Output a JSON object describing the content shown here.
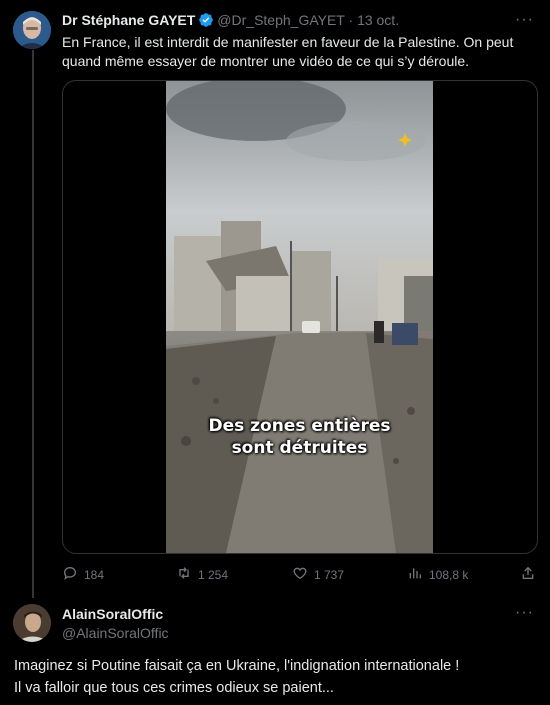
{
  "tweet1": {
    "display_name": "Dr Stéphane GAYET",
    "handle": "@Dr_Steph_GAYET",
    "separator": "·",
    "time": "13 oct.",
    "text": "En France, il est interdit de manifester en faveur de la Palestine. On peut quand même essayer de montrer une vidéo de ce qui s’y déroule.",
    "video_caption_line1": "Des zones entières",
    "video_caption_line2": "sont détruites",
    "stats": {
      "replies": "184",
      "reposts": "1 254",
      "likes": "1 737",
      "views": "108,8 k"
    }
  },
  "tweet2": {
    "display_name": "AlainSoralOffic",
    "handle": "@AlainSoralOffic",
    "text_line1": "Imaginez si Poutine faisait ça en Ukraine, l'indignation internationale !",
    "text_line2": "Il va falloir que tous ces crimes odieux se paient..."
  },
  "icons": {
    "more": "more-icon",
    "verified": "verified-icon",
    "reply": "reply-icon",
    "repost": "repost-icon",
    "like": "like-icon",
    "views": "views-icon",
    "share": "share-icon"
  },
  "colors": {
    "background": "#000000",
    "text": "#e7e9ea",
    "secondary": "#71767b",
    "verified": "#1d9bf0",
    "border": "#2f3336"
  }
}
